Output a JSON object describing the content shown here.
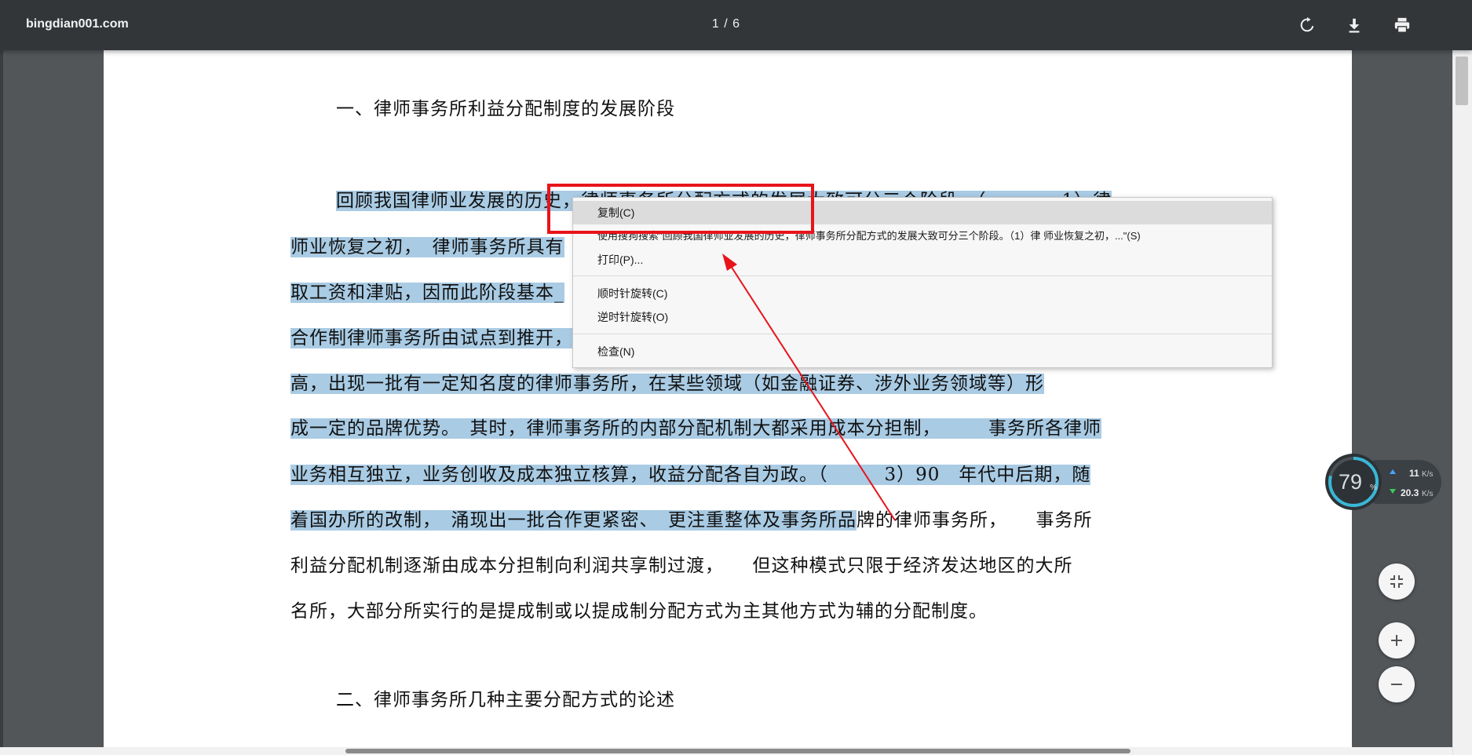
{
  "toolbar": {
    "site_title": "bingdian001.com",
    "page_indicator": "1 / 6",
    "rotate_icon": "rotate-clockwise-icon",
    "download_icon": "download-icon",
    "print_icon": "print-icon"
  },
  "document": {
    "heading1": "一、律师事务所利益分配制度的发展阶段",
    "paragraph_lines": [
      "回顾我国律师业发展的历史，律师事务所分配方式的发展大致可分三个阶段。（　　　　1）律",
      "师业恢复之初，　律师事务所具有",
      "取工资和津贴，因而此阶段基本_",
      "合作制律师事务所由试点到推开，",
      "高，出现一批有一定知名度的律师事务所，在某些领域（如金融证券、涉外业务领域等）形",
      "成一定的品牌优势。　其时，律师事务所的内部分配机制大都采用成本分担制，　　　事务所各律师",
      "业务相互独立，业务创收及成本独立核算，收益分配各自为政。（　　　3）90　年代中后期，随",
      "着国办所的改制，　涌现出一批合作更紧密、　更注重整体及事务所品",
      "牌的律师事务所，　　事务所",
      "利益分配机制逐渐由成本分担制向利润共享制过渡，　　但这种模式只限于经济发达地区的大所",
      "名所，大部分所实行的是提成制或以提成制分配方式为主其他方式为辅的分配制度。"
    ],
    "heading2": "二、律师事务所几种主要分配方式的论述"
  },
  "context_menu": {
    "items": [
      {
        "label": "复制(C)",
        "active": true
      },
      {
        "label": "使用搜狗搜索\"回顾我国律师业发展的历史，律师事务所分配方式的发展大致可分三个阶段。（1）律  师业恢复之初，...\"(S)",
        "active": false
      },
      {
        "label": "打印(P)...",
        "active": false
      },
      {
        "label": "顺时针旋转(C)",
        "active": false
      },
      {
        "label": "逆时针旋转(O)",
        "active": false
      },
      {
        "label": "检查(N)",
        "active": false
      }
    ]
  },
  "speed_widget": {
    "percent": "79",
    "percent_unit": "%",
    "upload": "11",
    "upload_unit": "K/s",
    "download": "20.3",
    "download_unit": "K/s",
    "progress": 0.79
  },
  "zoom_controls": {
    "fit_icon": "fit-to-page-icon",
    "zoom_in_icon": "plus-icon",
    "zoom_out_icon": "minus-icon"
  },
  "colors": {
    "toolbar_bg": "#323639",
    "viewer_bg": "#525659",
    "highlight": "#a9cbe4",
    "annotation_red": "#e8141b",
    "gauge_ring": "#39b7d6"
  }
}
